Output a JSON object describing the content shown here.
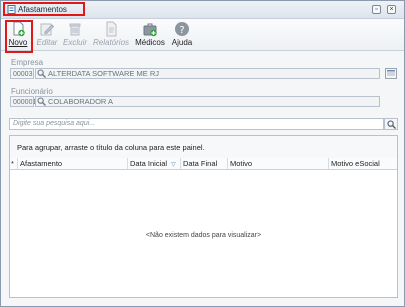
{
  "window": {
    "title": "Afastamentos",
    "icon": "document-app-icon",
    "buttons": [
      "restore",
      "close"
    ]
  },
  "toolbar": {
    "items": [
      {
        "label": "Novo",
        "icon": "new-document-icon",
        "enabled": true
      },
      {
        "label": "Editar",
        "icon": "edit-icon",
        "enabled": false
      },
      {
        "label": "Excluir",
        "icon": "trash-icon",
        "enabled": false
      },
      {
        "label": "Relatórios",
        "icon": "report-icon",
        "enabled": false
      },
      {
        "label": "Médicos",
        "icon": "doctor-icon",
        "enabled": true
      },
      {
        "label": "Ajuda",
        "icon": "help-icon",
        "enabled": true
      }
    ]
  },
  "empresa": {
    "label": "Empresa",
    "code": "00003",
    "name": "ALTERDATA SOFTWARE ME RJ"
  },
  "funcionario": {
    "label": "Funcionário",
    "code": "000001",
    "name": "COLABORADOR A"
  },
  "search": {
    "placeholder": "Digite sua pesquisa aqui..."
  },
  "grid": {
    "group_hint": "Para agrupar, arraste o título da coluna para este painel.",
    "columns": [
      "Afastamento",
      "Data Inicial",
      "Data Final",
      "Motivo",
      "Motivo eSocial"
    ],
    "row_indicator": "*",
    "empty_message": "<Não existem dados para visualizar>"
  },
  "colors": {
    "highlight": "#e01818",
    "accent": "#6b8ab0"
  }
}
